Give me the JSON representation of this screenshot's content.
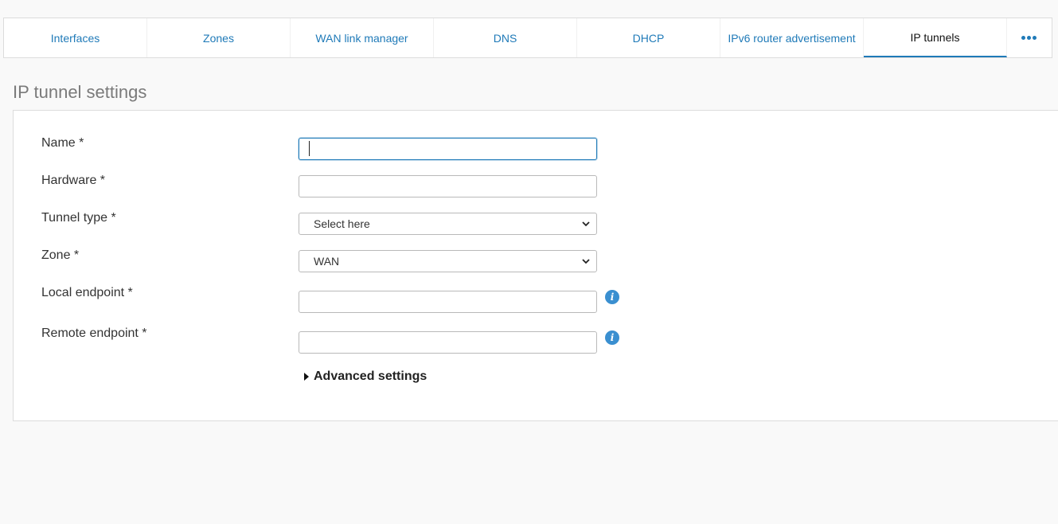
{
  "tabs": [
    {
      "label": "Interfaces",
      "active": false
    },
    {
      "label": "Zones",
      "active": false
    },
    {
      "label": "WAN link manager",
      "active": false
    },
    {
      "label": "DNS",
      "active": false
    },
    {
      "label": "DHCP",
      "active": false
    },
    {
      "label": "IPv6 router advertisement",
      "active": false
    },
    {
      "label": "IP tunnels",
      "active": true
    }
  ],
  "more_icon": "more-dots-icon",
  "section": {
    "title": "IP tunnel settings"
  },
  "form": {
    "name": {
      "label": "Name *",
      "value": ""
    },
    "hardware": {
      "label": "Hardware *",
      "value": ""
    },
    "tunnel_type": {
      "label": "Tunnel type *",
      "selected": "Select here"
    },
    "zone": {
      "label": "Zone *",
      "selected": "WAN"
    },
    "local_endpoint": {
      "label": "Local endpoint *",
      "value": "",
      "info_glyph": "i"
    },
    "remote_endpoint": {
      "label": "Remote endpoint *",
      "value": "",
      "info_glyph": "i"
    },
    "advanced_settings": "Advanced settings"
  },
  "colors": {
    "accent": "#1f7ab8",
    "info": "#3a8fd0"
  }
}
